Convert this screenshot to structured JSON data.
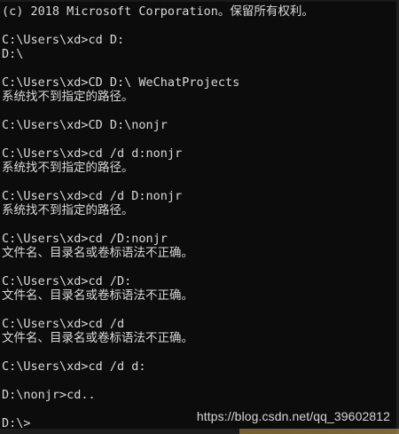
{
  "console": {
    "lines": [
      "(c) 2018 Microsoft Corporation。保留所有权利。",
      "",
      "C:\\Users\\xd>cd D:",
      "D:\\",
      "",
      "C:\\Users\\xd>CD D:\\ WeChatProjects",
      "系统找不到指定的路径。",
      "",
      "C:\\Users\\xd>CD D:\\nonjr",
      "",
      "C:\\Users\\xd>cd /d d:nonjr",
      "系统找不到指定的路径。",
      "",
      "C:\\Users\\xd>cd /d D:nonjr",
      "系统找不到指定的路径。",
      "",
      "C:\\Users\\xd>cd /D:nonjr",
      "文件名、目录名或卷标语法不正确。",
      "",
      "C:\\Users\\xd>cd /D:",
      "文件名、目录名或卷标语法不正确。",
      "",
      "C:\\Users\\xd>cd /d",
      "文件名、目录名或卷标语法不正确。",
      "",
      "C:\\Users\\xd>cd /d d:",
      "",
      "D:\\nonjr>cd..",
      "",
      "D:\\>"
    ]
  },
  "watermark": {
    "text": "https://blog.csdn.net/qq_39602812"
  },
  "colors": {
    "background": "#0c0c0c",
    "text": "#d9d9d9"
  }
}
